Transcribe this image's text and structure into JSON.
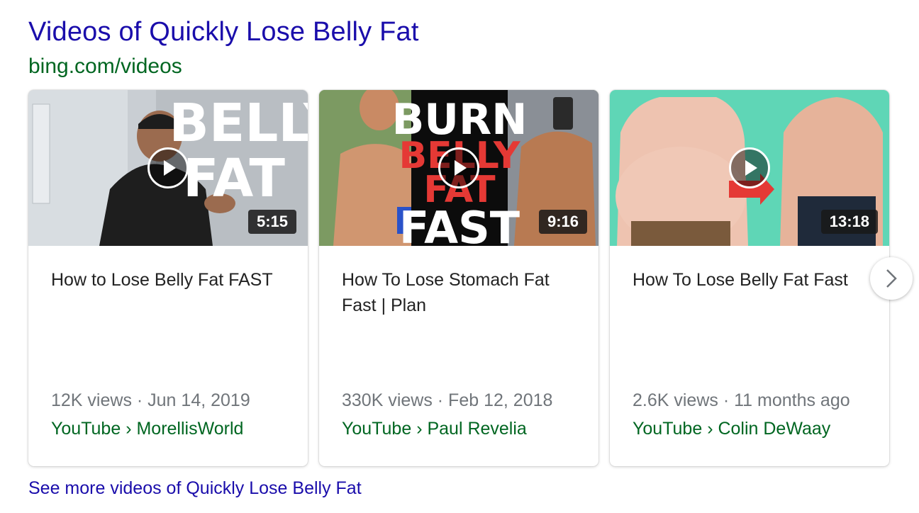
{
  "header": {
    "title": "Videos of Quickly Lose Belly Fat",
    "site": "bing.com/videos"
  },
  "cards": [
    {
      "title": "How to Lose Belly Fat FAST",
      "duration": "5:15",
      "meta": "12K views · Jun 14, 2019",
      "source": "YouTube › MorellisWorld",
      "thumb_text": [
        "BELLY",
        "FAT"
      ]
    },
    {
      "title": "How To Lose Stomach Fat Fast | Plan",
      "duration": "9:16",
      "meta": "330K views · Feb 12, 2018",
      "source": "YouTube › Paul Revelia",
      "thumb_text": [
        "BURN",
        "BELLY",
        "FAT",
        "FAST"
      ]
    },
    {
      "title": "How To Lose Belly Fat Fast",
      "duration": "13:18",
      "meta": "2.6K views · 11 months ago",
      "source": "YouTube › Colin DeWaay"
    }
  ],
  "footer": {
    "more_link": "See more videos of Quickly Lose Belly Fat"
  },
  "icons": {
    "play": "play-icon",
    "next": "chevron-right-icon"
  },
  "colors": {
    "link": "#1a0dab",
    "url_green": "#006621",
    "meta_gray": "#70757a"
  }
}
